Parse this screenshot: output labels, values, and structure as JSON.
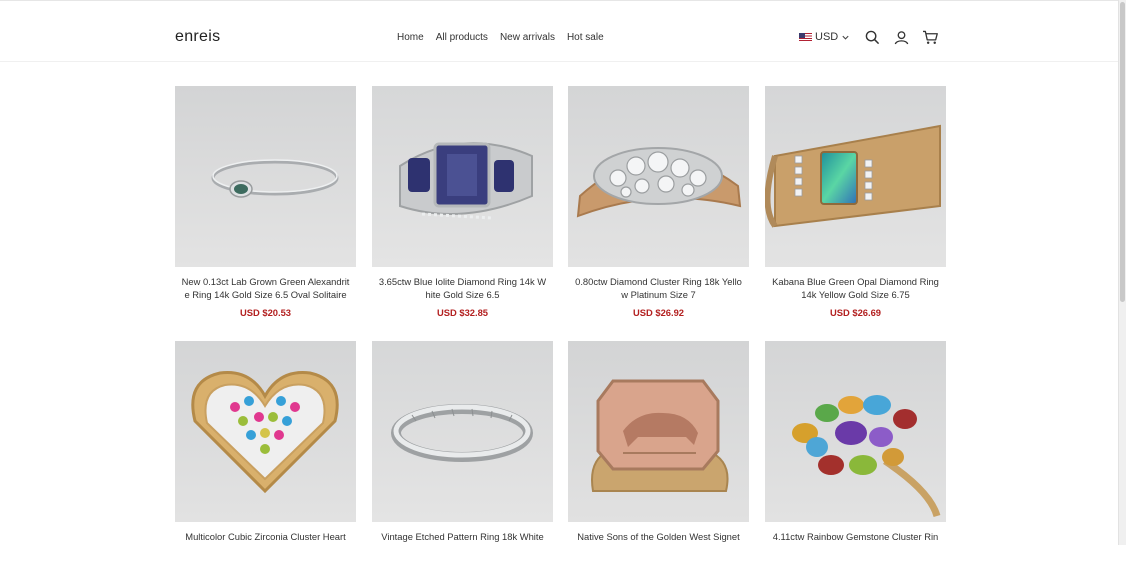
{
  "brand": "enreis",
  "nav": [
    "Home",
    "All products",
    "New arrivals",
    "Hot sale"
  ],
  "currency": "USD",
  "icons": [
    "search-icon",
    "account-icon",
    "cart-icon",
    "chevron-down-icon"
  ],
  "products": [
    {
      "title": "New 0.13ct Lab Grown Green Alexandrite Ring 14k Gold Size 6.5 Oval Solitaire",
      "title_lines": [
        "New 0.13ct Lab Grown Green Alexandrit",
        "e Ring 14k Gold Size 6.5 Oval Solitaire"
      ],
      "price": "USD $20.53"
    },
    {
      "title": "3.65ctw Blue Iolite Diamond Ring 14k White Gold Size 6.5",
      "title_lines": [
        "3.65ctw Blue Iolite Diamond Ring 14k W",
        "hite Gold Size 6.5"
      ],
      "price": "USD $32.85"
    },
    {
      "title": "0.80ctw Diamond Cluster Ring 18k Yellow Platinum Size 7",
      "title_lines": [
        "0.80ctw Diamond Cluster Ring 18k Yello",
        "w Platinum Size 7"
      ],
      "price": "USD $26.92"
    },
    {
      "title": "Kabana Blue Green Opal Diamond Ring 14k Yellow Gold Size 6.75",
      "title_lines": [
        "Kabana Blue Green Opal Diamond Ring",
        "14k Yellow Gold Size 6.75"
      ],
      "price": "USD $26.69"
    },
    {
      "title": "Multicolor Cubic Zirconia Cluster Heart",
      "title_lines": [
        "Multicolor Cubic Zirconia Cluster Heart",
        ""
      ],
      "price": ""
    },
    {
      "title": "Vintage Etched Pattern Ring 18k White",
      "title_lines": [
        "Vintage Etched Pattern Ring 18k White",
        ""
      ],
      "price": ""
    },
    {
      "title": "Native Sons of the Golden West Signet",
      "title_lines": [
        "Native Sons of the Golden West Signet",
        ""
      ],
      "price": ""
    },
    {
      "title": "4.11ctw Rainbow Gemstone Cluster Rin",
      "title_lines": [
        "4.11ctw Rainbow Gemstone Cluster Rin",
        ""
      ],
      "price": ""
    }
  ],
  "colors": {
    "price": "#b32020",
    "photo_bg": "#d8d8d8"
  }
}
